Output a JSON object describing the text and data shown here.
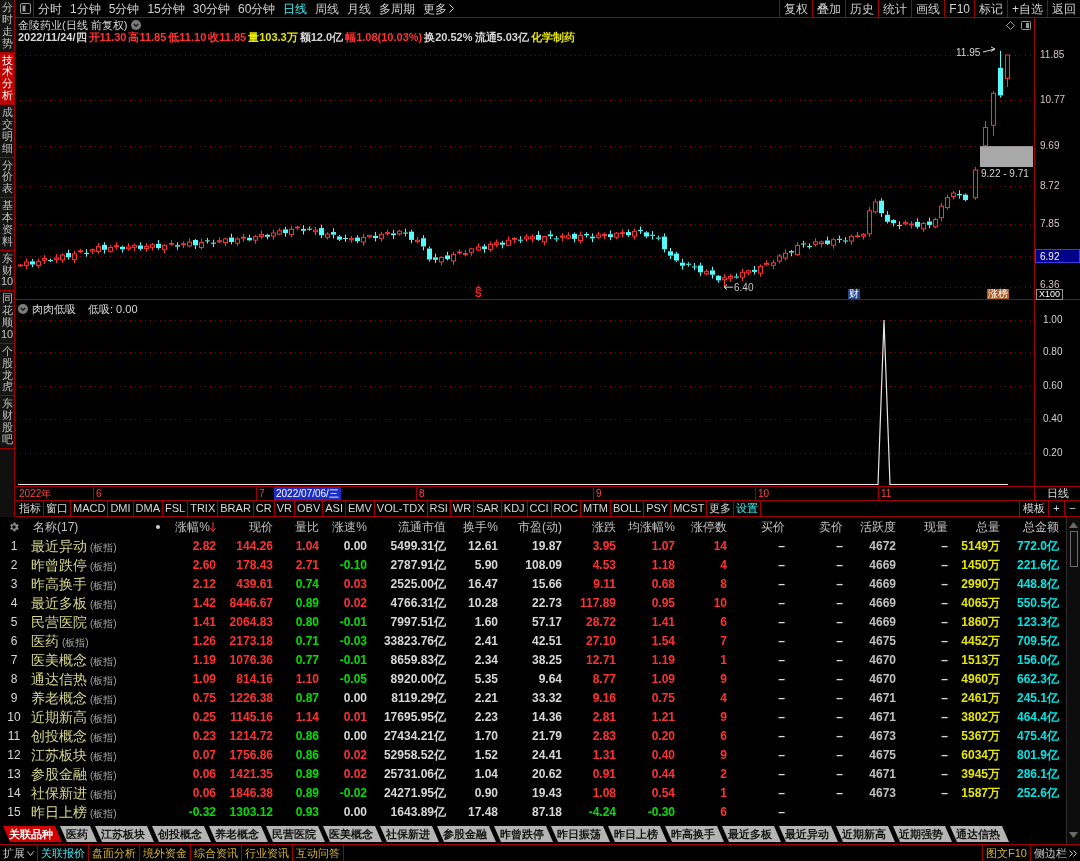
{
  "side_tabs": [
    {
      "label": "分时走势",
      "selected": false
    },
    {
      "label": "技术分析",
      "selected": true
    },
    {
      "label": "成交明细",
      "selected": false
    },
    {
      "label": "分价表",
      "selected": false
    },
    {
      "label": "基本资料",
      "selected": false
    },
    {
      "label": "东财10",
      "selected": false
    },
    {
      "label": "同花顺10",
      "selected": false
    },
    {
      "label": "个股龙虎",
      "selected": false
    },
    {
      "label": "东财股吧",
      "selected": false
    }
  ],
  "periods": [
    {
      "label": "分时",
      "selected": false
    },
    {
      "label": "1分钟",
      "selected": false
    },
    {
      "label": "5分钟",
      "selected": false
    },
    {
      "label": "15分钟",
      "selected": false
    },
    {
      "label": "30分钟",
      "selected": false
    },
    {
      "label": "60分钟",
      "selected": false
    },
    {
      "label": "日线",
      "selected": true
    },
    {
      "label": "周线",
      "selected": false
    },
    {
      "label": "月线",
      "selected": false
    },
    {
      "label": "多周期",
      "selected": false
    }
  ],
  "more_periods": "更多",
  "tools": [
    "复权",
    "叠加",
    "历史",
    "统计",
    "画线",
    "F10",
    "标记",
    "+自选",
    "返回"
  ],
  "chart": {
    "title": "金陵药业(日线 前复权)",
    "quote": [
      {
        "text": "2022/11/24/四",
        "color": "#d7d7d7"
      },
      {
        "text": "开11.30",
        "color": "#ff3232"
      },
      {
        "text": "高11.85",
        "color": "#ff3232"
      },
      {
        "text": "低11.10",
        "color": "#ff3232"
      },
      {
        "text": "收11.85",
        "color": "#ff3232"
      },
      {
        "text": "量103.3万",
        "color": "#e6e600"
      },
      {
        "text": "额12.0亿",
        "color": "#d7d7d7"
      },
      {
        "text": "幅1.08(10.03%)",
        "color": "#ff3232"
      },
      {
        "text": "换20.52%",
        "color": "#d7d7d7"
      },
      {
        "text": "流通5.03亿",
        "color": "#d7d7d7"
      },
      {
        "text": "化学制药",
        "color": "#e6e600"
      }
    ],
    "high_label": "11.95",
    "gap_label": "9.22 - 9.71",
    "low_label": "6.40",
    "markers": [
      {
        "label": "S",
        "kind": "signal"
      },
      {
        "label": "财",
        "kind": "finance"
      },
      {
        "label": "涨榜",
        "kind": "list"
      }
    ],
    "price_ticks": [
      "11.85",
      "10.77",
      "9.69",
      "8.72",
      "7.85"
    ],
    "current_price": "6.92",
    "bottom_tick": "6.36",
    "scale": "X100"
  },
  "indicator": {
    "name": "肉肉低吸",
    "reading": "低吸: 0.00",
    "ticks": [
      "1.00",
      "0.80",
      "0.60",
      "0.40",
      "0.20"
    ]
  },
  "date_axis": {
    "labels": [
      {
        "label": "2022年",
        "kind": "year"
      },
      {
        "label": "6",
        "kind": "month"
      },
      {
        "label": "7",
        "kind": "month"
      },
      {
        "label": "2022/07/06/三",
        "kind": "cursor"
      },
      {
        "label": "8",
        "kind": "month"
      },
      {
        "label": "9",
        "kind": "month"
      },
      {
        "label": "10",
        "kind": "month"
      },
      {
        "label": "11",
        "kind": "month"
      }
    ],
    "period": "日线"
  },
  "indicator_tabs": [
    {
      "label": "指标",
      "selected": false
    },
    {
      "label": "窗口",
      "selected": false
    },
    {
      "label": "MACD",
      "selected": false
    },
    {
      "label": "DMI",
      "selected": false
    },
    {
      "label": "DMA",
      "selected": false
    },
    {
      "label": "FSL",
      "selected": false
    },
    {
      "label": "TRIX",
      "selected": false
    },
    {
      "label": "BRAR",
      "selected": false
    },
    {
      "label": "CR",
      "selected": false
    },
    {
      "label": "VR",
      "selected": false
    },
    {
      "label": "OBV",
      "selected": false
    },
    {
      "label": "ASI",
      "selected": false
    },
    {
      "label": "EMV",
      "selected": false
    },
    {
      "label": "VOL-TDX",
      "selected": false
    },
    {
      "label": "RSI",
      "selected": false
    },
    {
      "label": "WR",
      "selected": false
    },
    {
      "label": "SAR",
      "selected": false
    },
    {
      "label": "KDJ",
      "selected": false
    },
    {
      "label": "CCI",
      "selected": false
    },
    {
      "label": "ROC",
      "selected": false
    },
    {
      "label": "MTM",
      "selected": false
    },
    {
      "label": "BOLL",
      "selected": false
    },
    {
      "label": "PSY",
      "selected": false
    },
    {
      "label": "MCST",
      "selected": false
    },
    {
      "label": "更多",
      "selected": false
    },
    {
      "label": "设置",
      "selected": true
    }
  ],
  "panel_buttons": [
    "模板",
    "+",
    "−"
  ],
  "table": {
    "columns": [
      {
        "label": "名称(17)"
      },
      {
        "label": "涨幅%",
        "sorted_descending": true
      },
      {
        "label": "现价"
      },
      {
        "label": "量比"
      },
      {
        "label": "涨速%"
      },
      {
        "label": "流通市值"
      },
      {
        "label": "换手%"
      },
      {
        "label": "市盈(动)"
      },
      {
        "label": "涨跌"
      },
      {
        "label": "均涨幅%"
      },
      {
        "label": "涨停数"
      },
      {
        "label": "买价"
      },
      {
        "label": "卖价"
      },
      {
        "label": "活跃度"
      },
      {
        "label": "现量"
      },
      {
        "label": "总量"
      },
      {
        "label": "总金额"
      }
    ],
    "rows": [
      {
        "no": "1",
        "cells": [
          {
            "text": "最近异动",
            "tag": "(板指)"
          },
          {
            "text": "2.82",
            "color": "#ff3232"
          },
          {
            "text": "144.26",
            "color": "#ff3232"
          },
          {
            "text": "1.04",
            "color": "#ff3232"
          },
          {
            "text": "0.00",
            "color": "#d7d7d7"
          },
          {
            "text": "5499.31亿"
          },
          {
            "text": "12.61"
          },
          {
            "text": "19.87"
          },
          {
            "text": "3.95",
            "color": "#ff3232"
          },
          {
            "text": "1.07",
            "color": "#ff3232"
          },
          {
            "text": "14"
          },
          {
            "text": "–"
          },
          {
            "text": "–"
          },
          {
            "text": "4672"
          },
          {
            "text": "–"
          },
          {
            "text": "5149万"
          },
          {
            "text": "772.0亿"
          }
        ]
      },
      {
        "no": "2",
        "cells": [
          {
            "text": "昨曾跌停",
            "tag": "(板指)"
          },
          {
            "text": "2.60",
            "color": "#ff3232"
          },
          {
            "text": "178.43",
            "color": "#ff3232"
          },
          {
            "text": "2.71",
            "color": "#ff3232"
          },
          {
            "text": "-0.10",
            "color": "#00e000"
          },
          {
            "text": "2787.91亿"
          },
          {
            "text": "5.90"
          },
          {
            "text": "108.09"
          },
          {
            "text": "4.53",
            "color": "#ff3232"
          },
          {
            "text": "1.18",
            "color": "#ff3232"
          },
          {
            "text": "4"
          },
          {
            "text": "–"
          },
          {
            "text": "–"
          },
          {
            "text": "4669"
          },
          {
            "text": "–"
          },
          {
            "text": "1450万"
          },
          {
            "text": "221.6亿"
          }
        ]
      },
      {
        "no": "3",
        "cells": [
          {
            "text": "昨高换手",
            "tag": "(板指)"
          },
          {
            "text": "2.12",
            "color": "#ff3232"
          },
          {
            "text": "439.61",
            "color": "#ff3232"
          },
          {
            "text": "0.74",
            "color": "#00e000"
          },
          {
            "text": "0.03",
            "color": "#ff3232"
          },
          {
            "text": "2525.00亿"
          },
          {
            "text": "16.47"
          },
          {
            "text": "15.66"
          },
          {
            "text": "9.11",
            "color": "#ff3232"
          },
          {
            "text": "0.68",
            "color": "#ff3232"
          },
          {
            "text": "8"
          },
          {
            "text": "–"
          },
          {
            "text": "–"
          },
          {
            "text": "4669"
          },
          {
            "text": "–"
          },
          {
            "text": "2990万"
          },
          {
            "text": "448.8亿"
          }
        ]
      },
      {
        "no": "4",
        "cells": [
          {
            "text": "最近多板",
            "tag": "(板指)"
          },
          {
            "text": "1.42",
            "color": "#ff3232"
          },
          {
            "text": "8446.67",
            "color": "#ff3232"
          },
          {
            "text": "0.89",
            "color": "#00e000"
          },
          {
            "text": "0.02",
            "color": "#ff3232"
          },
          {
            "text": "4766.31亿"
          },
          {
            "text": "10.28"
          },
          {
            "text": "22.73"
          },
          {
            "text": "117.89",
            "color": "#ff3232"
          },
          {
            "text": "0.95",
            "color": "#ff3232"
          },
          {
            "text": "10"
          },
          {
            "text": "–"
          },
          {
            "text": "–"
          },
          {
            "text": "4669"
          },
          {
            "text": "–"
          },
          {
            "text": "4065万"
          },
          {
            "text": "550.5亿"
          }
        ]
      },
      {
        "no": "5",
        "cells": [
          {
            "text": "民营医院",
            "tag": "(板指)"
          },
          {
            "text": "1.41",
            "color": "#ff3232"
          },
          {
            "text": "2064.83",
            "color": "#ff3232"
          },
          {
            "text": "0.80",
            "color": "#00e000"
          },
          {
            "text": "-0.01",
            "color": "#00e000"
          },
          {
            "text": "7997.51亿"
          },
          {
            "text": "1.60"
          },
          {
            "text": "57.17"
          },
          {
            "text": "28.72",
            "color": "#ff3232"
          },
          {
            "text": "1.41",
            "color": "#ff3232"
          },
          {
            "text": "6"
          },
          {
            "text": "–"
          },
          {
            "text": "–"
          },
          {
            "text": "4669"
          },
          {
            "text": "–"
          },
          {
            "text": "1860万"
          },
          {
            "text": "123.3亿"
          }
        ]
      },
      {
        "no": "6",
        "cells": [
          {
            "text": "医药",
            "tag": "(板指)"
          },
          {
            "text": "1.26",
            "color": "#ff3232"
          },
          {
            "text": "2173.18",
            "color": "#ff3232"
          },
          {
            "text": "0.71",
            "color": "#00e000"
          },
          {
            "text": "-0.03",
            "color": "#00e000"
          },
          {
            "text": "33823.76亿"
          },
          {
            "text": "2.41"
          },
          {
            "text": "42.51"
          },
          {
            "text": "27.10",
            "color": "#ff3232"
          },
          {
            "text": "1.54",
            "color": "#ff3232"
          },
          {
            "text": "7"
          },
          {
            "text": "–"
          },
          {
            "text": "–"
          },
          {
            "text": "4675"
          },
          {
            "text": "–"
          },
          {
            "text": "4452万"
          },
          {
            "text": "709.5亿"
          }
        ]
      },
      {
        "no": "7",
        "cells": [
          {
            "text": "医美概念",
            "tag": "(板指)"
          },
          {
            "text": "1.19",
            "color": "#ff3232"
          },
          {
            "text": "1076.36",
            "color": "#ff3232"
          },
          {
            "text": "0.77",
            "color": "#00e000"
          },
          {
            "text": "-0.01",
            "color": "#00e000"
          },
          {
            "text": "8659.83亿"
          },
          {
            "text": "2.34"
          },
          {
            "text": "38.25"
          },
          {
            "text": "12.71",
            "color": "#ff3232"
          },
          {
            "text": "1.19",
            "color": "#ff3232"
          },
          {
            "text": "1"
          },
          {
            "text": "–"
          },
          {
            "text": "–"
          },
          {
            "text": "4670"
          },
          {
            "text": "–"
          },
          {
            "text": "1513万"
          },
          {
            "text": "156.0亿"
          }
        ]
      },
      {
        "no": "8",
        "cells": [
          {
            "text": "通达信热",
            "tag": "(板指)"
          },
          {
            "text": "1.09",
            "color": "#ff3232"
          },
          {
            "text": "814.16",
            "color": "#ff3232"
          },
          {
            "text": "1.10",
            "color": "#ff3232"
          },
          {
            "text": "-0.05",
            "color": "#00e000"
          },
          {
            "text": "8920.00亿"
          },
          {
            "text": "5.35"
          },
          {
            "text": "9.64"
          },
          {
            "text": "8.77",
            "color": "#ff3232"
          },
          {
            "text": "1.09",
            "color": "#ff3232"
          },
          {
            "text": "9"
          },
          {
            "text": "–"
          },
          {
            "text": "–"
          },
          {
            "text": "4670"
          },
          {
            "text": "–"
          },
          {
            "text": "4960万"
          },
          {
            "text": "662.3亿"
          }
        ]
      },
      {
        "no": "9",
        "cells": [
          {
            "text": "养老概念",
            "tag": "(板指)"
          },
          {
            "text": "0.75",
            "color": "#ff3232"
          },
          {
            "text": "1226.38",
            "color": "#ff3232"
          },
          {
            "text": "0.87",
            "color": "#00e000"
          },
          {
            "text": "0.00",
            "color": "#d7d7d7"
          },
          {
            "text": "8119.29亿"
          },
          {
            "text": "2.21"
          },
          {
            "text": "33.32"
          },
          {
            "text": "9.16",
            "color": "#ff3232"
          },
          {
            "text": "0.75",
            "color": "#ff3232"
          },
          {
            "text": "4"
          },
          {
            "text": "–"
          },
          {
            "text": "–"
          },
          {
            "text": "4671"
          },
          {
            "text": "–"
          },
          {
            "text": "2461万"
          },
          {
            "text": "245.1亿"
          }
        ]
      },
      {
        "no": "10",
        "cells": [
          {
            "text": "近期新高",
            "tag": "(板指)"
          },
          {
            "text": "0.25",
            "color": "#ff3232"
          },
          {
            "text": "1145.16",
            "color": "#ff3232"
          },
          {
            "text": "1.14",
            "color": "#ff3232"
          },
          {
            "text": "0.01",
            "color": "#ff3232"
          },
          {
            "text": "17695.95亿"
          },
          {
            "text": "2.23"
          },
          {
            "text": "14.36"
          },
          {
            "text": "2.81",
            "color": "#ff3232"
          },
          {
            "text": "1.21",
            "color": "#ff3232"
          },
          {
            "text": "9"
          },
          {
            "text": "–"
          },
          {
            "text": "–"
          },
          {
            "text": "4671"
          },
          {
            "text": "–"
          },
          {
            "text": "3802万"
          },
          {
            "text": "464.4亿"
          }
        ]
      },
      {
        "no": "11",
        "cells": [
          {
            "text": "创投概念",
            "tag": "(板指)"
          },
          {
            "text": "0.23",
            "color": "#ff3232"
          },
          {
            "text": "1214.72",
            "color": "#ff3232"
          },
          {
            "text": "0.86",
            "color": "#00e000"
          },
          {
            "text": "0.00",
            "color": "#d7d7d7"
          },
          {
            "text": "27434.21亿"
          },
          {
            "text": "1.70"
          },
          {
            "text": "21.79"
          },
          {
            "text": "2.83",
            "color": "#ff3232"
          },
          {
            "text": "0.20",
            "color": "#ff3232"
          },
          {
            "text": "6"
          },
          {
            "text": "–"
          },
          {
            "text": "–"
          },
          {
            "text": "4673"
          },
          {
            "text": "–"
          },
          {
            "text": "5367万"
          },
          {
            "text": "475.4亿"
          }
        ]
      },
      {
        "no": "12",
        "cells": [
          {
            "text": "江苏板块",
            "tag": "(板指)"
          },
          {
            "text": "0.07",
            "color": "#ff3232"
          },
          {
            "text": "1756.86",
            "color": "#ff3232"
          },
          {
            "text": "0.86",
            "color": "#00e000"
          },
          {
            "text": "0.02",
            "color": "#ff3232"
          },
          {
            "text": "52958.52亿"
          },
          {
            "text": "1.52"
          },
          {
            "text": "24.41"
          },
          {
            "text": "1.31",
            "color": "#ff3232"
          },
          {
            "text": "0.40",
            "color": "#ff3232"
          },
          {
            "text": "9"
          },
          {
            "text": "–"
          },
          {
            "text": "–"
          },
          {
            "text": "4675"
          },
          {
            "text": "–"
          },
          {
            "text": "6034万"
          },
          {
            "text": "801.9亿"
          }
        ]
      },
      {
        "no": "13",
        "cells": [
          {
            "text": "参股金融",
            "tag": "(板指)"
          },
          {
            "text": "0.06",
            "color": "#ff3232"
          },
          {
            "text": "1421.35",
            "color": "#ff3232"
          },
          {
            "text": "0.89",
            "color": "#00e000"
          },
          {
            "text": "0.02",
            "color": "#ff3232"
          },
          {
            "text": "25731.06亿"
          },
          {
            "text": "1.04"
          },
          {
            "text": "20.62"
          },
          {
            "text": "0.91",
            "color": "#ff3232"
          },
          {
            "text": "0.44",
            "color": "#ff3232"
          },
          {
            "text": "2"
          },
          {
            "text": "–"
          },
          {
            "text": "–"
          },
          {
            "text": "4671"
          },
          {
            "text": "–"
          },
          {
            "text": "3945万"
          },
          {
            "text": "286.1亿"
          }
        ]
      },
      {
        "no": "14",
        "cells": [
          {
            "text": "社保新进",
            "tag": "(板指)"
          },
          {
            "text": "0.06",
            "color": "#ff3232"
          },
          {
            "text": "1846.38",
            "color": "#ff3232"
          },
          {
            "text": "0.89",
            "color": "#00e000"
          },
          {
            "text": "-0.02",
            "color": "#00e000"
          },
          {
            "text": "24271.95亿"
          },
          {
            "text": "0.90"
          },
          {
            "text": "19.43"
          },
          {
            "text": "1.08",
            "color": "#ff3232"
          },
          {
            "text": "0.54",
            "color": "#ff3232"
          },
          {
            "text": "1"
          },
          {
            "text": "–"
          },
          {
            "text": "–"
          },
          {
            "text": "4673"
          },
          {
            "text": "–"
          },
          {
            "text": "1587万"
          },
          {
            "text": "252.6亿"
          }
        ]
      },
      {
        "no": "15",
        "cells": [
          {
            "text": "昨日上榜",
            "tag": "(板指)"
          },
          {
            "text": "-0.32",
            "color": "#00e000"
          },
          {
            "text": "1303.12",
            "color": "#00e000"
          },
          {
            "text": "0.93",
            "color": "#00e000"
          },
          {
            "text": "0.00",
            "color": "#d7d7d7"
          },
          {
            "text": "1643.89亿"
          },
          {
            "text": "17.48"
          },
          {
            "text": "87.18"
          },
          {
            "text": "-4.24",
            "color": "#00e000"
          },
          {
            "text": "-0.30",
            "color": "#00e000"
          },
          {
            "text": "6"
          },
          {
            "text": "–"
          }
        ]
      }
    ]
  },
  "sheet_tabs": [
    {
      "label": "关联品种",
      "selected": true
    },
    {
      "label": "医药",
      "selected": false
    },
    {
      "label": "江苏板块",
      "selected": false
    },
    {
      "label": "创投概念",
      "selected": false
    },
    {
      "label": "养老概念",
      "selected": false
    },
    {
      "label": "民营医院",
      "selected": false
    },
    {
      "label": "医美概念",
      "selected": false
    },
    {
      "label": "社保新进",
      "selected": false
    },
    {
      "label": "参股金融",
      "selected": false
    },
    {
      "label": "昨曾跌停",
      "selected": false
    },
    {
      "label": "昨日振荡",
      "selected": false
    },
    {
      "label": "昨日上榜",
      "selected": false
    },
    {
      "label": "昨高换手",
      "selected": false
    },
    {
      "label": "最近多板",
      "selected": false
    },
    {
      "label": "最近异动",
      "selected": false
    },
    {
      "label": "近期新高",
      "selected": false
    },
    {
      "label": "近期强势",
      "selected": false
    },
    {
      "label": "通达信热",
      "selected": false
    }
  ],
  "status_bar": {
    "expand": "扩展",
    "items": [
      {
        "label": "关联报价",
        "selected": true
      },
      {
        "label": "盘面分析",
        "selected": false
      },
      {
        "label": "境外资金",
        "selected": false
      },
      {
        "label": "综合资讯",
        "selected": false
      },
      {
        "label": "行业资讯",
        "selected": false
      },
      {
        "label": "互动问答",
        "selected": false
      }
    ],
    "f10": "图文F10",
    "sidebar": "侧边栏"
  }
}
